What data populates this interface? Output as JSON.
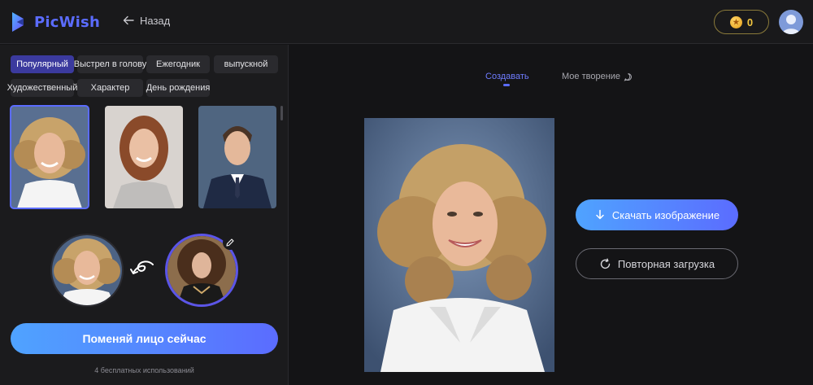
{
  "header": {
    "brand": "PicWish",
    "back_label": "Назад",
    "coin_count": "0"
  },
  "categories": [
    {
      "label": "Популярный",
      "active": true
    },
    {
      "label": "Выстрел в голову",
      "active": false
    },
    {
      "label": "Ежегодник",
      "active": false
    },
    {
      "label": "выпускной",
      "active": false
    },
    {
      "label": "Художественный",
      "active": false
    },
    {
      "label": "Характер",
      "active": false
    },
    {
      "label": "День рождения",
      "active": false
    }
  ],
  "swap_button": "Поменяй лицо сейчас",
  "free_uses": "4 бесплатных использований",
  "tabs": {
    "create": "Создавать",
    "my_creation": "Мое творение"
  },
  "actions": {
    "download": "Скачать изображение",
    "reload": "Повторная загрузка"
  },
  "colors": {
    "accent": "#5b6cff",
    "active_chip": "#3b3a9e",
    "coin": "#f2c640"
  }
}
